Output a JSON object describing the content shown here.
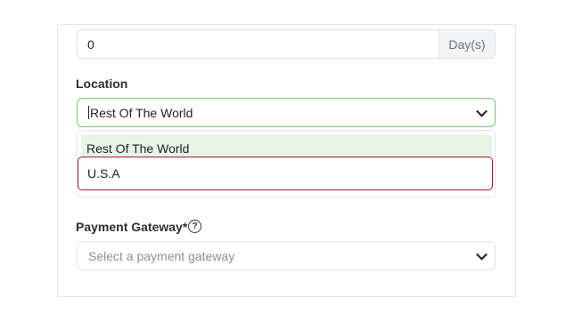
{
  "duration": {
    "value": "0",
    "unit": "Day(s)"
  },
  "location": {
    "label": "Location",
    "selected": "Rest Of The World",
    "options": [
      "Rest Of The World",
      "U.S.A"
    ]
  },
  "payment": {
    "label": "Payment Gateway*",
    "help_icon": "?",
    "placeholder": "Select a payment gateway"
  }
}
